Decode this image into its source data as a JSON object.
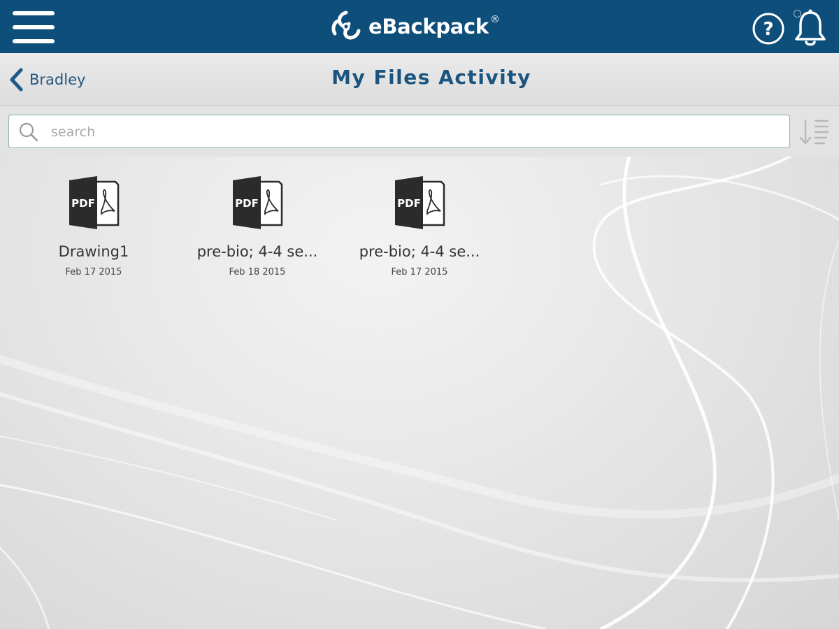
{
  "app": {
    "brand_name": "eBackpack",
    "brand_mark": "®"
  },
  "header": {
    "menu_icon": "hamburger-menu-icon",
    "help_icon": "question-circle-icon",
    "notification_icon": "bell-icon"
  },
  "nav": {
    "back_label": "Bradley",
    "back_icon": "chevron-left-icon",
    "title": "My Files Activity"
  },
  "search": {
    "placeholder": "search",
    "value": "",
    "icon": "search-icon",
    "sort_icon": "sort-descending-icon"
  },
  "files": [
    {
      "name": "Drawing1",
      "date": "Feb 17 2015",
      "type_label": "PDF",
      "icon": "pdf-file-icon"
    },
    {
      "name": "pre-bio; 4-4 se...",
      "date": "Feb 18 2015",
      "type_label": "PDF",
      "icon": "pdf-file-icon"
    },
    {
      "name": "pre-bio; 4-4 se...",
      "date": "Feb 17 2015",
      "type_label": "PDF",
      "icon": "pdf-file-icon"
    }
  ],
  "colors": {
    "header_bg": "#0e4e7a",
    "title_text": "#1b557f",
    "search_border": "#7fb39f"
  }
}
